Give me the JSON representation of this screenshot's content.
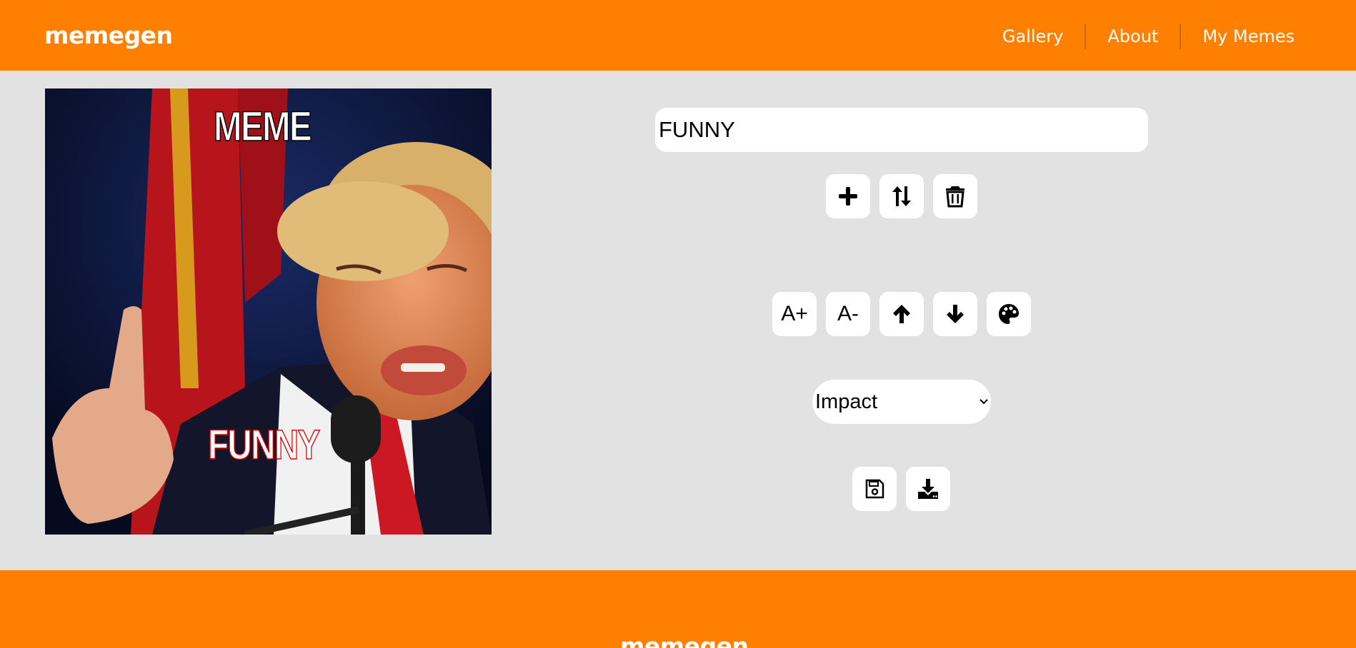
{
  "header": {
    "logo": "memegen",
    "nav": [
      {
        "label": "Gallery"
      },
      {
        "label": "About"
      },
      {
        "label": "My Memes"
      }
    ]
  },
  "meme": {
    "top_text": "MEME",
    "bottom_text": "FUNNY",
    "top_text_outline_color": "#000000",
    "bottom_text_outline_color": "#e00000"
  },
  "editor": {
    "text_input_value": "FUNNY",
    "buttons": {
      "add_line": "plus-icon",
      "switch_line": "swap-vertical-icon",
      "delete_line": "trash-icon",
      "increase_font": "A+",
      "decrease_font": "A-",
      "move_up": "arrow-up-icon",
      "move_down": "arrow-down-icon",
      "color": "palette-icon",
      "save": "floppy-disk-icon",
      "download": "download-icon"
    },
    "font_select": {
      "selected": "Impact"
    }
  },
  "footer": {
    "logo": "memegen"
  },
  "colors": {
    "brand": "#ff7f00",
    "background": "#e2e2e2"
  }
}
